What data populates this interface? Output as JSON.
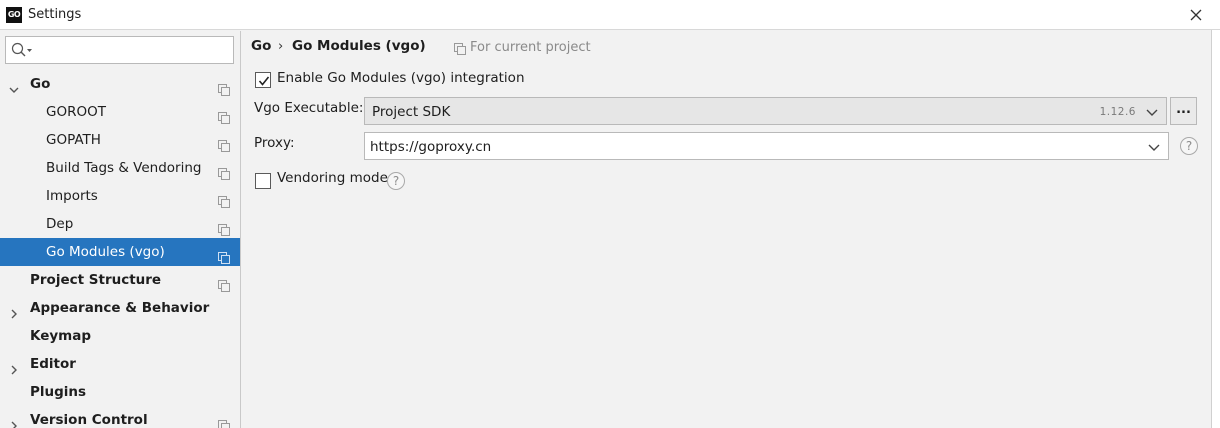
{
  "window": {
    "title": "Settings",
    "logo_text": "GO"
  },
  "search": {
    "placeholder": ""
  },
  "sidebar": {
    "items": [
      {
        "label": "Go"
      },
      {
        "label": "GOROOT"
      },
      {
        "label": "GOPATH"
      },
      {
        "label": "Build Tags & Vendoring"
      },
      {
        "label": "Imports"
      },
      {
        "label": "Dep"
      },
      {
        "label": "Go Modules (vgo)"
      },
      {
        "label": "Project Structure"
      },
      {
        "label": "Appearance & Behavior"
      },
      {
        "label": "Keymap"
      },
      {
        "label": "Editor"
      },
      {
        "label": "Plugins"
      },
      {
        "label": "Version Control"
      }
    ]
  },
  "breadcrumb": {
    "parent": "Go",
    "separator": "›",
    "current": "Go Modules (vgo)",
    "scope": "For current project"
  },
  "form": {
    "enable_label": "Enable Go Modules (vgo) integration",
    "enable_checked": true,
    "vgo_label": "Vgo Executable:",
    "vgo_value": "Project SDK",
    "vgo_version": "1.12.6",
    "browse_label": "...",
    "proxy_label": "Proxy:",
    "proxy_value": "https://goproxy.cn",
    "vendoring_label": "Vendoring mode",
    "vendoring_checked": false,
    "help_symbol": "?"
  },
  "colors": {
    "selection": "#2675bf",
    "background": "#f2f2f2"
  }
}
